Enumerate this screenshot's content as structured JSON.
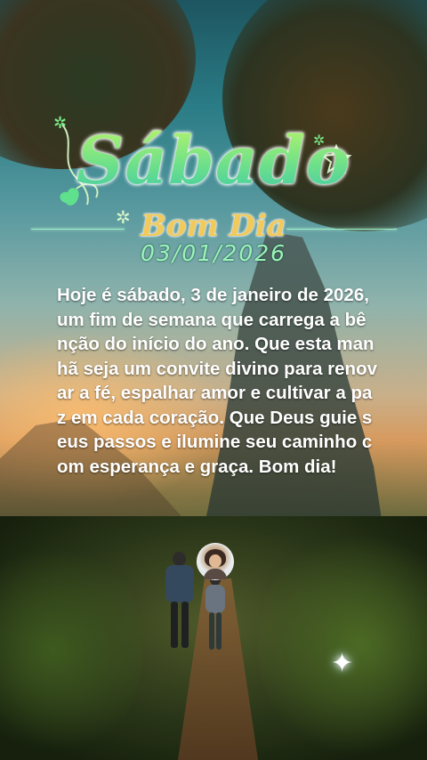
{
  "title": "Sábado",
  "subtitle": "Bom Dia",
  "date": "03/01/2026",
  "message": "Hoje é sábado, 3 de janeiro de 2026, um fim de semana que carrega a bênção do início do ano. Que esta manhã seja um convite divino para renovar a fé, espalhar amor e cultivar a paz em cada coração. Que Deus guie seus passos e ilumine seu caminho com esperança e graça. Bom dia!",
  "colors": {
    "title_gradient_top": "#b8f56a",
    "title_gradient_bottom": "#3ec9a8",
    "subtitle": "#f2c95b",
    "date": "#9af5b8",
    "message": "#ffffff"
  },
  "icons": [
    "sparkle-icon",
    "heart-leaf-icon",
    "star-icon"
  ]
}
